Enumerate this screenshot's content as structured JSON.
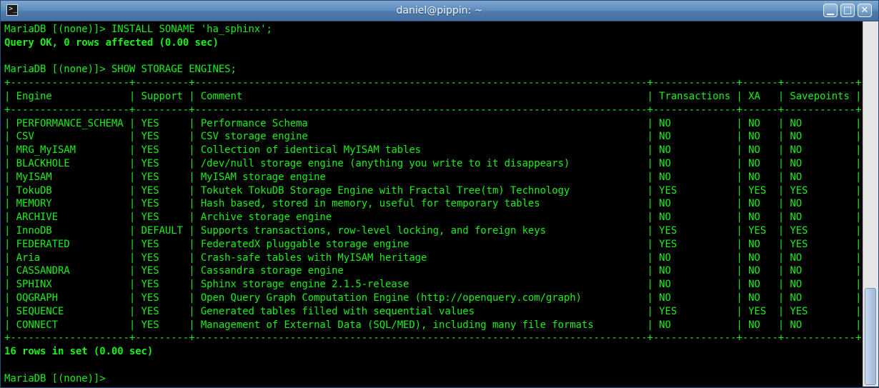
{
  "window": {
    "title": "daniel@pippin: ~",
    "icon_glyph": ">_",
    "buttons": {
      "minimize": "▁",
      "maximize": "□",
      "close": "✕"
    }
  },
  "terminal": {
    "text_color": "#18f018",
    "background": "#000000",
    "lines": [
      {
        "text": "MariaDB [(none)]> INSTALL SONAME 'ha_sphinx';",
        "bold": false
      },
      {
        "text": "Query OK, 0 rows affected (0.00 sec)",
        "bold": true
      },
      {
        "text": "",
        "bold": false
      },
      {
        "text": "MariaDB [(none)]> SHOW STORAGE ENGINES;",
        "bold": false
      },
      {
        "text": "+--------------------+---------+----------------------------------------------------------------------------+--------------+------+------------+",
        "bold": false
      },
      {
        "text": "| Engine             | Support | Comment                                                                    | Transactions | XA   | Savepoints |",
        "bold": false
      },
      {
        "text": "+--------------------+---------+----------------------------------------------------------------------------+--------------+------+------------+",
        "bold": false
      },
      {
        "text": "| PERFORMANCE_SCHEMA | YES     | Performance Schema                                                         | NO           | NO   | NO         |",
        "bold": false
      },
      {
        "text": "| CSV                | YES     | CSV storage engine                                                         | NO           | NO   | NO         |",
        "bold": false
      },
      {
        "text": "| MRG_MyISAM         | YES     | Collection of identical MyISAM tables                                      | NO           | NO   | NO         |",
        "bold": false
      },
      {
        "text": "| BLACKHOLE          | YES     | /dev/null storage engine (anything you write to it disappears)             | NO           | NO   | NO         |",
        "bold": false
      },
      {
        "text": "| MyISAM             | YES     | MyISAM storage engine                                                      | NO           | NO   | NO         |",
        "bold": false
      },
      {
        "text": "| TokuDB             | YES     | Tokutek TokuDB Storage Engine with Fractal Tree(tm) Technology             | YES          | YES  | YES        |",
        "bold": false
      },
      {
        "text": "| MEMORY             | YES     | Hash based, stored in memory, useful for temporary tables                  | NO           | NO   | NO         |",
        "bold": false
      },
      {
        "text": "| ARCHIVE            | YES     | Archive storage engine                                                     | NO           | NO   | NO         |",
        "bold": false
      },
      {
        "text": "| InnoDB             | DEFAULT | Supports transactions, row-level locking, and foreign keys                 | YES          | YES  | YES        |",
        "bold": false
      },
      {
        "text": "| FEDERATED          | YES     | FederatedX pluggable storage engine                                        | YES          | NO   | YES        |",
        "bold": false
      },
      {
        "text": "| Aria               | YES     | Crash-safe tables with MyISAM heritage                                     | NO           | NO   | NO         |",
        "bold": false
      },
      {
        "text": "| CASSANDRA          | YES     | Cassandra storage engine                                                   | NO           | NO   | NO         |",
        "bold": false
      },
      {
        "text": "| SPHINX             | YES     | Sphinx storage engine 2.1.5-release                                        | NO           | NO   | NO         |",
        "bold": false
      },
      {
        "text": "| OQGRAPH            | YES     | Open Query Graph Computation Engine (http://openquery.com/graph)           | NO           | NO   | NO         |",
        "bold": false
      },
      {
        "text": "| SEQUENCE           | YES     | Generated tables filled with sequential values                             | YES          | YES  | YES        |",
        "bold": false
      },
      {
        "text": "| CONNECT            | YES     | Management of External Data (SQL/MED), including many file formats         | NO           | NO   | NO         |",
        "bold": false
      },
      {
        "text": "+--------------------+---------+----------------------------------------------------------------------------+--------------+------+------------+",
        "bold": false
      },
      {
        "text": "16 rows in set (0.00 sec)",
        "bold": true
      },
      {
        "text": "",
        "bold": false
      },
      {
        "text": "MariaDB [(none)]> ",
        "bold": false
      }
    ]
  },
  "scrollbar": {
    "thumb_position": 0.73,
    "thumb_size": 0.27
  }
}
